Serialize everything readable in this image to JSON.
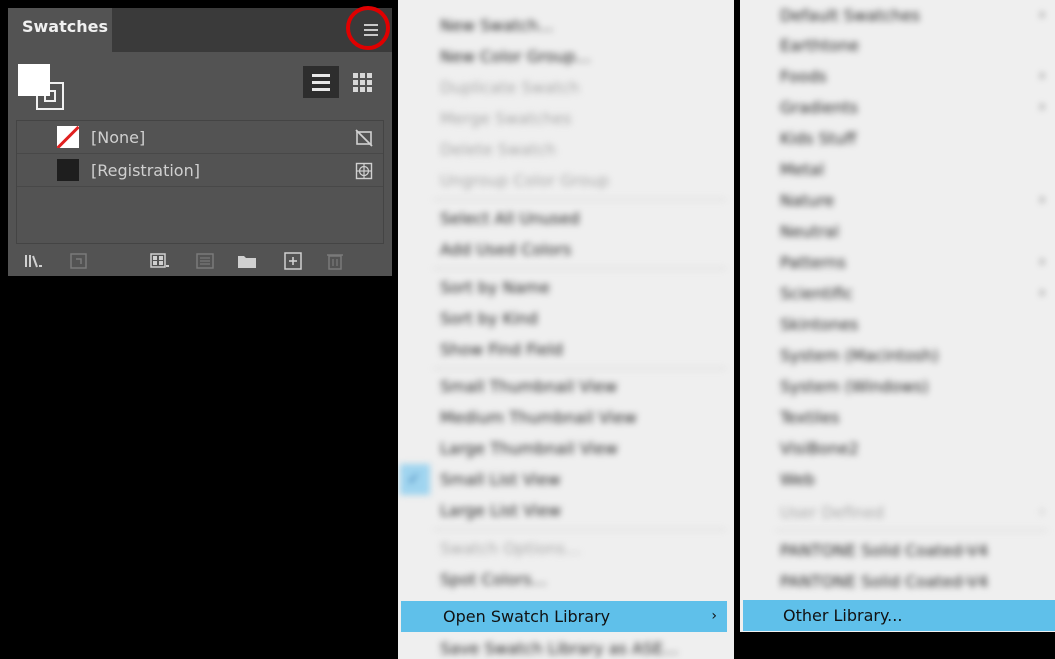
{
  "panel": {
    "tab_label": "Swatches",
    "swatches": [
      {
        "name": "[None]"
      },
      {
        "name": "[Registration]"
      }
    ]
  },
  "menu1": {
    "items": [
      {
        "label": "New Swatch...",
        "disabled": false
      },
      {
        "label": "New Color Group...",
        "disabled": false
      },
      {
        "label": "Duplicate Swatch",
        "disabled": true
      },
      {
        "label": "Merge Swatches",
        "disabled": true
      },
      {
        "label": "Delete Swatch",
        "disabled": true
      },
      {
        "label": "Ungroup Color Group",
        "disabled": true
      },
      {
        "label": "Select All Unused",
        "disabled": false
      },
      {
        "label": "Add Used Colors",
        "disabled": false
      },
      {
        "label": "Sort by Name",
        "disabled": false
      },
      {
        "label": "Sort by Kind",
        "disabled": false
      },
      {
        "label": "Show Find Field",
        "disabled": false
      },
      {
        "label": "Small Thumbnail View",
        "disabled": false
      },
      {
        "label": "Medium Thumbnail View",
        "disabled": false
      },
      {
        "label": "Large Thumbnail View",
        "disabled": false
      },
      {
        "label": "Small List View",
        "disabled": false,
        "checked": true
      },
      {
        "label": "Large List View",
        "disabled": false
      },
      {
        "label": "Swatch Options...",
        "disabled": true
      },
      {
        "label": "Spot Colors...",
        "disabled": false
      },
      {
        "label": "Open Swatch Library",
        "highlighted": true
      },
      {
        "label": "Save Swatch Library as ASE...",
        "disabled": false
      }
    ]
  },
  "menu2": {
    "items": [
      {
        "label": "Default Swatches",
        "submenu": true
      },
      {
        "label": "Earthtone"
      },
      {
        "label": "Foods",
        "submenu": true
      },
      {
        "label": "Gradients",
        "submenu": true
      },
      {
        "label": "Kids Stuff"
      },
      {
        "label": "Metal"
      },
      {
        "label": "Nature",
        "submenu": true
      },
      {
        "label": "Neutral"
      },
      {
        "label": "Patterns",
        "submenu": true
      },
      {
        "label": "Scientific",
        "submenu": true
      },
      {
        "label": "Skintones"
      },
      {
        "label": "System (Macintosh)"
      },
      {
        "label": "System (Windows)"
      },
      {
        "label": "Textiles"
      },
      {
        "label": "VisiBone2"
      },
      {
        "label": "Web"
      },
      {
        "label": "User Defined",
        "disabled": true,
        "submenu": true
      },
      {
        "label": "PANTONE Solid Coated-V4"
      },
      {
        "label": "PANTONE Solid Coated-V4"
      },
      {
        "label": "Other Library...",
        "highlighted": true
      }
    ]
  },
  "colors": {
    "highlight": "#5fc0ea",
    "panel_bg": "#535353",
    "menu_bg": "#efefef",
    "annotation_ring": "#e00000"
  }
}
